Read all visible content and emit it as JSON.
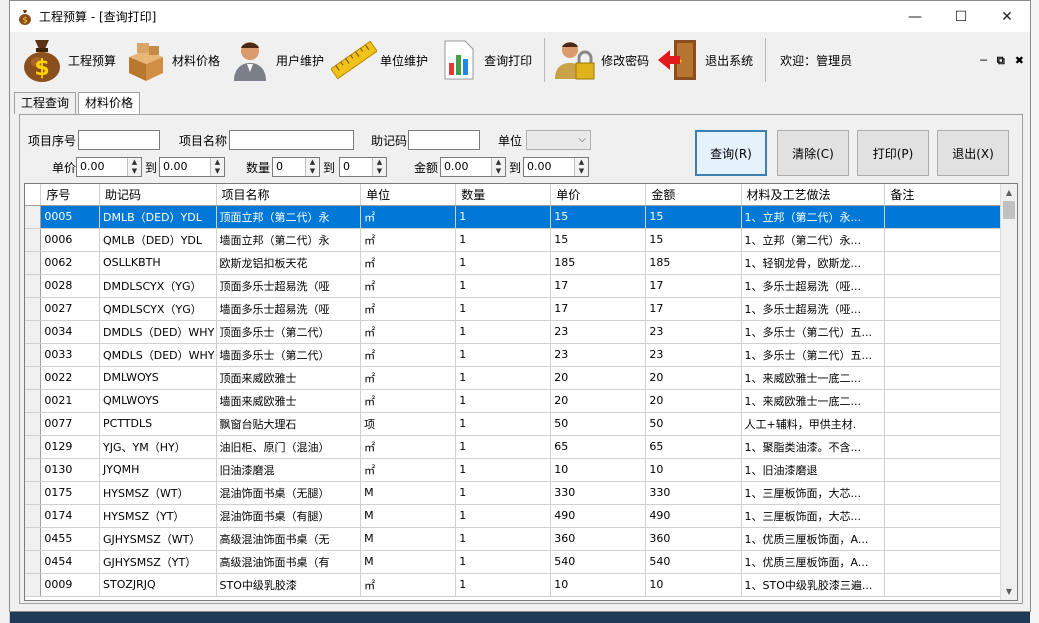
{
  "window": {
    "title": "工程预算 - [查询打印]"
  },
  "toolbar": {
    "items": [
      {
        "label": "工程预算",
        "icon": "money-bag-icon"
      },
      {
        "label": "材料价格",
        "icon": "boxes-icon"
      },
      {
        "label": "用户维护",
        "icon": "user-icon"
      },
      {
        "label": "单位维护",
        "icon": "ruler-icon"
      },
      {
        "label": "查询打印",
        "icon": "chart-report-icon"
      },
      {
        "label": "修改密码",
        "icon": "user-lock-icon"
      },
      {
        "label": "退出系统",
        "icon": "exit-door-icon"
      }
    ],
    "welcome": "欢迎：管理员"
  },
  "tabs": [
    "工程查询",
    "材料价格"
  ],
  "filters": {
    "seq_label": "项目序号",
    "seq_value": "",
    "name_label": "项目名称",
    "name_value": "",
    "code_label": "助记码",
    "code_value": "",
    "unit_label": "单位",
    "unit_value": "",
    "price_label": "单价",
    "price_from": "0.00",
    "price_to": "0.00",
    "qty_label": "数量",
    "qty_from": "0",
    "qty_to": "0",
    "amount_label": "金额",
    "amount_from": "0.00",
    "amount_to": "0.00",
    "to_label": "到"
  },
  "buttons": {
    "query": "查询(R)",
    "clear": "清除(C)",
    "print": "打印(P)",
    "exit": "退出(X)"
  },
  "grid": {
    "columns": [
      "序号",
      "助记码",
      "项目名称",
      "单位",
      "数量",
      "单价",
      "金额",
      "材料及工艺做法",
      "备注"
    ],
    "rows": [
      [
        "0005",
        "DMLB（DED）YDL",
        "顶面立邦（第二代）永",
        "㎡",
        "1",
        "15",
        "15",
        "1、立邦（第二代）永...",
        ""
      ],
      [
        "0006",
        "QMLB（DED）YDL",
        "墙面立邦（第二代）永",
        "㎡",
        "1",
        "15",
        "15",
        "1、立邦（第二代）永...",
        ""
      ],
      [
        "0062",
        "OSLLKBTH",
        "欧斯龙铝扣板天花",
        "㎡",
        "1",
        "185",
        "185",
        "1、轻钢龙骨，欧斯龙...",
        ""
      ],
      [
        "0028",
        "DMDLSCYX（YG）",
        "顶面多乐士超易洗（哑",
        "㎡",
        "1",
        "17",
        "17",
        "1、多乐士超易洗（哑...",
        ""
      ],
      [
        "0027",
        "QMDLSCYX（YG）",
        "墙面多乐士超易洗（哑",
        "㎡",
        "1",
        "17",
        "17",
        "1、多乐士超易洗（哑...",
        ""
      ],
      [
        "0034",
        "DMDLS（DED）WHY",
        "顶面多乐士（第二代）",
        "㎡",
        "1",
        "23",
        "23",
        "1、多乐士（第二代）五...",
        ""
      ],
      [
        "0033",
        "QMDLS（DED）WHY",
        "墙面多乐士（第二代）",
        "㎡",
        "1",
        "23",
        "23",
        "1、多乐士（第二代）五...",
        ""
      ],
      [
        "0022",
        "DMLWOYS",
        "顶面来威欧雅士",
        "㎡",
        "1",
        "20",
        "20",
        "1、来威欧雅士一底二...",
        ""
      ],
      [
        "0021",
        "QMLWOYS",
        "墙面来威欧雅士",
        "㎡",
        "1",
        "20",
        "20",
        "1、来威欧雅士一底二...",
        ""
      ],
      [
        "0077",
        "PCTTDLS",
        "飘窗台贴大理石",
        "项",
        "1",
        "50",
        "50",
        "人工+辅料，甲供主材.",
        ""
      ],
      [
        "0129",
        "YJG、YM（HY）",
        "油旧柜、原门（混油）",
        "㎡",
        "1",
        "65",
        "65",
        "1、聚脂类油漆。不含...",
        ""
      ],
      [
        "0130",
        "JYQMH",
        "旧油漆磨混",
        "㎡",
        "1",
        "10",
        "10",
        "1、旧油漆磨退",
        ""
      ],
      [
        "0175",
        "HYSMSZ（WT）",
        "混油饰面书桌（无腿）",
        "M",
        "1",
        "330",
        "330",
        "1、三厘板饰面，大芯...",
        ""
      ],
      [
        "0174",
        "HYSMSZ（YT）",
        "混油饰面书桌（有腿）",
        "M",
        "1",
        "490",
        "490",
        "1、三厘板饰面，大芯...",
        ""
      ],
      [
        "0455",
        "GJHYSMSZ（WT）",
        "高级混油饰面书桌（无",
        "M",
        "1",
        "360",
        "360",
        "1、优质三厘板饰面，A...",
        ""
      ],
      [
        "0454",
        "GJHYSMSZ（YT）",
        "高级混油饰面书桌（有",
        "M",
        "1",
        "540",
        "540",
        "1、优质三厘板饰面，A...",
        ""
      ],
      [
        "0009",
        "STOZJRJQ",
        "STO中级乳胶漆",
        "㎡",
        "1",
        "10",
        "10",
        "1、STO中级乳胶漆三遍...",
        ""
      ]
    ]
  }
}
